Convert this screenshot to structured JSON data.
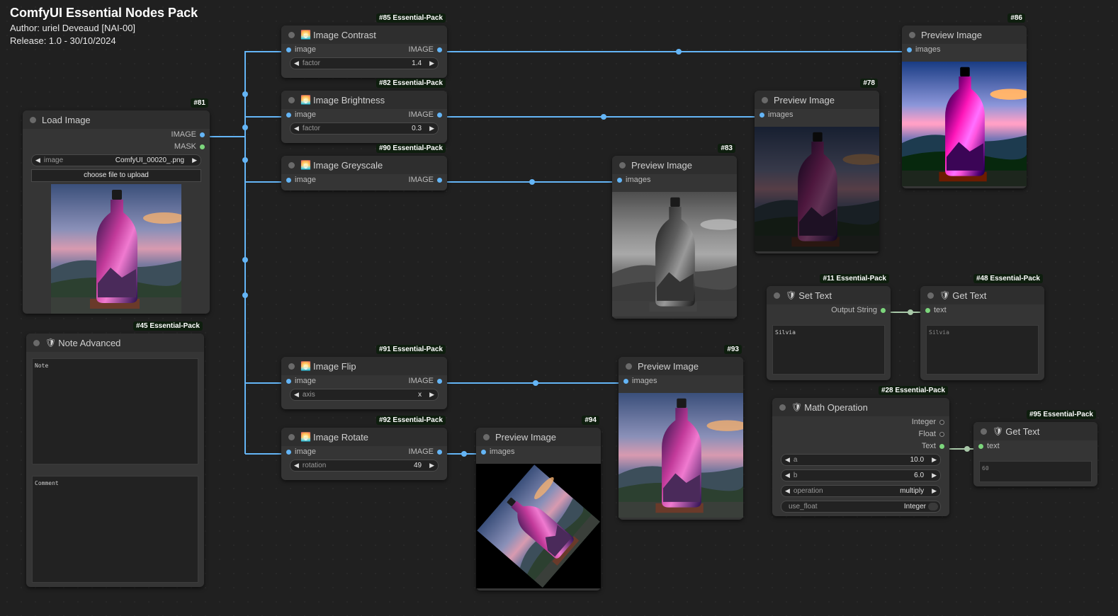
{
  "header": {
    "title": "ComfyUI Essential Nodes Pack",
    "author": "Author: uriel Deveaud [NAI-00]",
    "release": "Release: 1.0 - 30/10/2024"
  },
  "load_image": {
    "id": "#81",
    "title": "Load Image",
    "out_image": "IMAGE",
    "out_mask": "MASK",
    "widget_label": "image",
    "widget_value": "ComfyUI_00020_.png",
    "upload": "choose file to upload"
  },
  "note": {
    "id": "#45 Essential-Pack",
    "title": "Note Advanced",
    "note_text": "Note",
    "comment_text": "Comment"
  },
  "contrast": {
    "id": "#85 Essential-Pack",
    "title": "Image Contrast",
    "in": "image",
    "out": "IMAGE",
    "widget_label": "factor",
    "widget_value": "1.4"
  },
  "brightness": {
    "id": "#82 Essential-Pack",
    "title": "Image Brightness",
    "in": "image",
    "out": "IMAGE",
    "widget_label": "factor",
    "widget_value": "0.3"
  },
  "greyscale": {
    "id": "#90 Essential-Pack",
    "title": "Image Greyscale",
    "in": "image",
    "out": "IMAGE"
  },
  "flip": {
    "id": "#91 Essential-Pack",
    "title": "Image Flip",
    "in": "image",
    "out": "IMAGE",
    "widget_label": "axis",
    "widget_value": "x"
  },
  "rotate": {
    "id": "#92 Essential-Pack",
    "title": "Image Rotate",
    "in": "image",
    "out": "IMAGE",
    "widget_label": "rotation",
    "widget_value": "49"
  },
  "preview86": {
    "id": "#86",
    "title": "Preview Image",
    "in": "images"
  },
  "preview78": {
    "id": "#78",
    "title": "Preview Image",
    "in": "images"
  },
  "preview83": {
    "id": "#83",
    "title": "Preview Image",
    "in": "images"
  },
  "preview93": {
    "id": "#93",
    "title": "Preview Image",
    "in": "images"
  },
  "preview94": {
    "id": "#94",
    "title": "Preview Image",
    "in": "images"
  },
  "set_text": {
    "id": "#11 Essential-Pack",
    "title": "Set Text",
    "out": "Output String",
    "value": "Silvia"
  },
  "get_text48": {
    "id": "#48 Essential-Pack",
    "title": "Get Text",
    "in": "text",
    "value": "Silvia"
  },
  "math": {
    "id": "#28 Essential-Pack",
    "title": "Math Operation",
    "out_int": "Integer",
    "out_float": "Float",
    "out_text": "Text",
    "a_label": "a",
    "a_value": "10.0",
    "b_label": "b",
    "b_value": "6.0",
    "op_label": "operation",
    "op_value": "multiply",
    "float_label": "use_float",
    "float_value": "Integer"
  },
  "get_text95": {
    "id": "#95 Essential-Pack",
    "title": "Get Text",
    "in": "text",
    "value": "60"
  },
  "colors": {
    "wire": "#64b5f6",
    "text_wire": "#a8c8a8",
    "node_bg": "#353535",
    "title_bg": "#2e2e2e"
  },
  "icons": {
    "image_nodes": "sunset-icon",
    "text_nodes": "shield-icon"
  }
}
